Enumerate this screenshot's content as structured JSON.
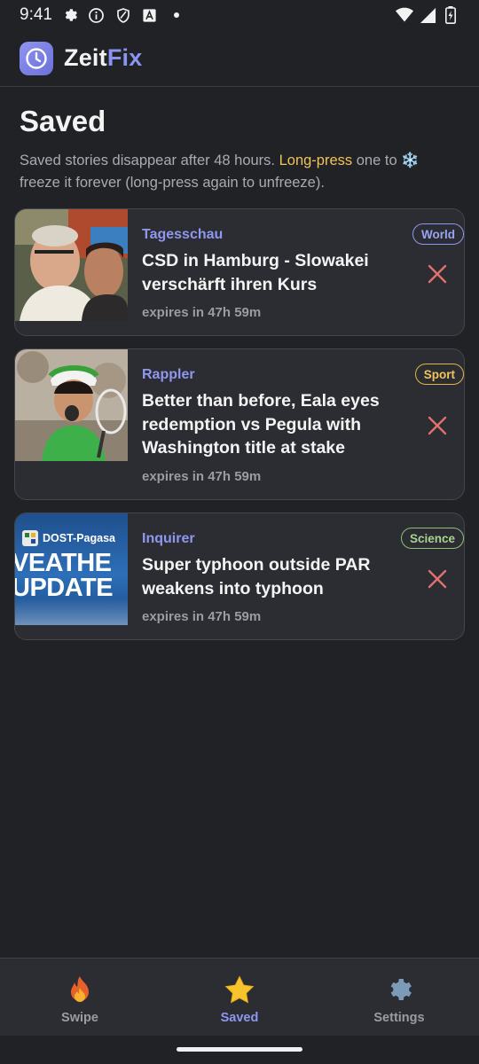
{
  "status_bar": {
    "time": "9:41"
  },
  "app": {
    "title_part1": "Zeit",
    "title_part2": "Fix",
    "accent_color": "#8a93f0"
  },
  "page": {
    "title": "Saved",
    "desc_before": "Saved stories disappear after 48 hours. ",
    "desc_highlight": "Long-press",
    "desc_after": " one to ❄️ freeze it forever (long-press again to unfreeze)."
  },
  "stories": [
    {
      "source": "Tagesschau",
      "category": "World",
      "headline": "CSD in Hamburg - Slowakei verschärft ihren Kurs",
      "expires": "expires in 47h 59m",
      "thumbnail": "two-men-photo"
    },
    {
      "source": "Rappler",
      "category": "Sport",
      "headline": "Better than before, Eala eyes redemption vs Pegula with Washington title at stake",
      "expires": "expires in 47h 59m",
      "thumbnail": "tennis-player-photo"
    },
    {
      "source": "Inquirer",
      "category": "Science",
      "headline": "Super typhoon outside PAR weakens into typhoon",
      "expires": "expires in 47h 59m",
      "thumbnail": "weather-update-graphic",
      "thumbnail_text": {
        "brand": "DOST-Pagasa",
        "line1": "VEATHE",
        "line2": "UPDATE"
      }
    }
  ],
  "nav": {
    "items": [
      {
        "label": "Swipe",
        "icon": "fire-icon",
        "active": false
      },
      {
        "label": "Saved",
        "icon": "star-icon",
        "active": true
      },
      {
        "label": "Settings",
        "icon": "gear-icon",
        "active": false
      }
    ]
  }
}
